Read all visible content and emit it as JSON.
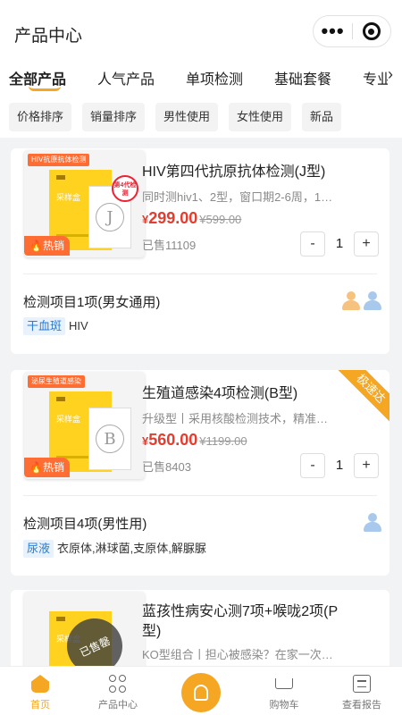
{
  "header": {
    "title": "产品中心"
  },
  "tabs": [
    "全部产品",
    "人气产品",
    "单项检测",
    "基础套餐",
    "专业"
  ],
  "filters": [
    "价格排序",
    "销量排序",
    "男性使用",
    "女性使用",
    "新品"
  ],
  "products": [
    {
      "image_corner_label": "HIV抗原抗体检测",
      "image_badge": "第4代检测",
      "image_letter": "J",
      "image_box_text": "采样盒",
      "hot_label": "热销",
      "name": "HIV第四代抗原抗体检测(J型)",
      "desc": "同时测hiv1、2型，窗口期2-6周，1…",
      "currency": "¥",
      "price": "299.00",
      "old_price": "¥599.00",
      "sold": "已售11109",
      "quantity": "1",
      "item_title": "检测项目1项(男女通用)",
      "sample_tag": "干血斑",
      "items": "HIV",
      "gender": [
        "female",
        "male"
      ]
    },
    {
      "image_corner_label": "泌尿生殖道感染",
      "image_letter": "B",
      "image_box_text": "采样盒",
      "hot_label": "热销",
      "ribbon": "极速达",
      "name": "生殖道感染4项检测(B型)",
      "desc": "升级型丨采用核酸检测技术，精准…",
      "currency": "¥",
      "price": "560.00",
      "old_price": "¥1199.00",
      "sold": "已售8403",
      "quantity": "1",
      "item_title": "检测项目4项(男性用)",
      "sample_tag": "尿液",
      "items": "衣原体,淋球菌,支原体,解脲脲",
      "gender": [
        "male"
      ]
    },
    {
      "image_box_text": "采样盒",
      "stamp": "已售罄",
      "name": "蓝孩性病安心测7项+喉咙2项(P型)",
      "desc": "KO型组合丨担心被感染？在家一次…"
    }
  ],
  "bottom_nav": [
    {
      "label": "首页",
      "icon": "home-icon",
      "active": true
    },
    {
      "label": "产品中心",
      "icon": "grid-icon",
      "active": false
    },
    {
      "label": "",
      "icon": "doctor-icon",
      "active": false
    },
    {
      "label": "购物车",
      "icon": "cart-icon",
      "active": false
    },
    {
      "label": "查看报告",
      "icon": "report-icon",
      "active": false
    }
  ],
  "colors": {
    "accent": "#f5a623",
    "price": "#e23d2f",
    "hot": "#ff6d33",
    "tag_blue": "#2b7cd3"
  }
}
